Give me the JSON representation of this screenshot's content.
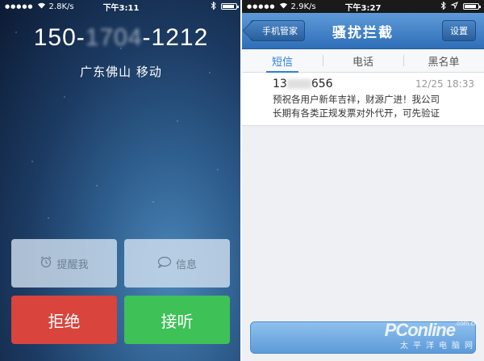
{
  "left_phone": {
    "status_bar": {
      "signal": "●●●●●",
      "speed": "2.8K/s",
      "time": "下午3:11",
      "battery_level": 0.85
    },
    "caller": {
      "number_prefix": "150-",
      "number_masked": "1704",
      "number_suffix": "-1212",
      "location": "广东佛山 移动"
    },
    "actions": {
      "remind_label": "提醒我",
      "message_label": "信息",
      "decline_label": "拒绝",
      "answer_label": "接听"
    }
  },
  "right_phone": {
    "status_bar": {
      "signal": "●●●●●",
      "speed": "2.9K/s",
      "time": "下午3:27",
      "battery_level": 0.85
    },
    "nav": {
      "back_label": "手机管家",
      "title": "骚扰拦截",
      "settings_label": "设置"
    },
    "tabs": [
      {
        "label": "短信",
        "active": true
      },
      {
        "label": "电话",
        "active": false
      },
      {
        "label": "黑名单",
        "active": false
      }
    ],
    "messages": [
      {
        "sender_prefix": "13",
        "sender_suffix": "656",
        "time": "12/25 18:33",
        "preview_line1": "预祝各用户新年吉祥，财源广进！我公司",
        "preview_line2": "长期有各类正规发票对外代开，可先验证"
      }
    ]
  },
  "watermark": {
    "main": "PConline",
    "domain": ".com.cn",
    "sub": "太平洋电脑网"
  },
  "colors": {
    "decline": "#d9443d",
    "answer": "#3ec157",
    "nav_blue": "#2f6fb8",
    "tab_active": "#2f7fd6"
  }
}
